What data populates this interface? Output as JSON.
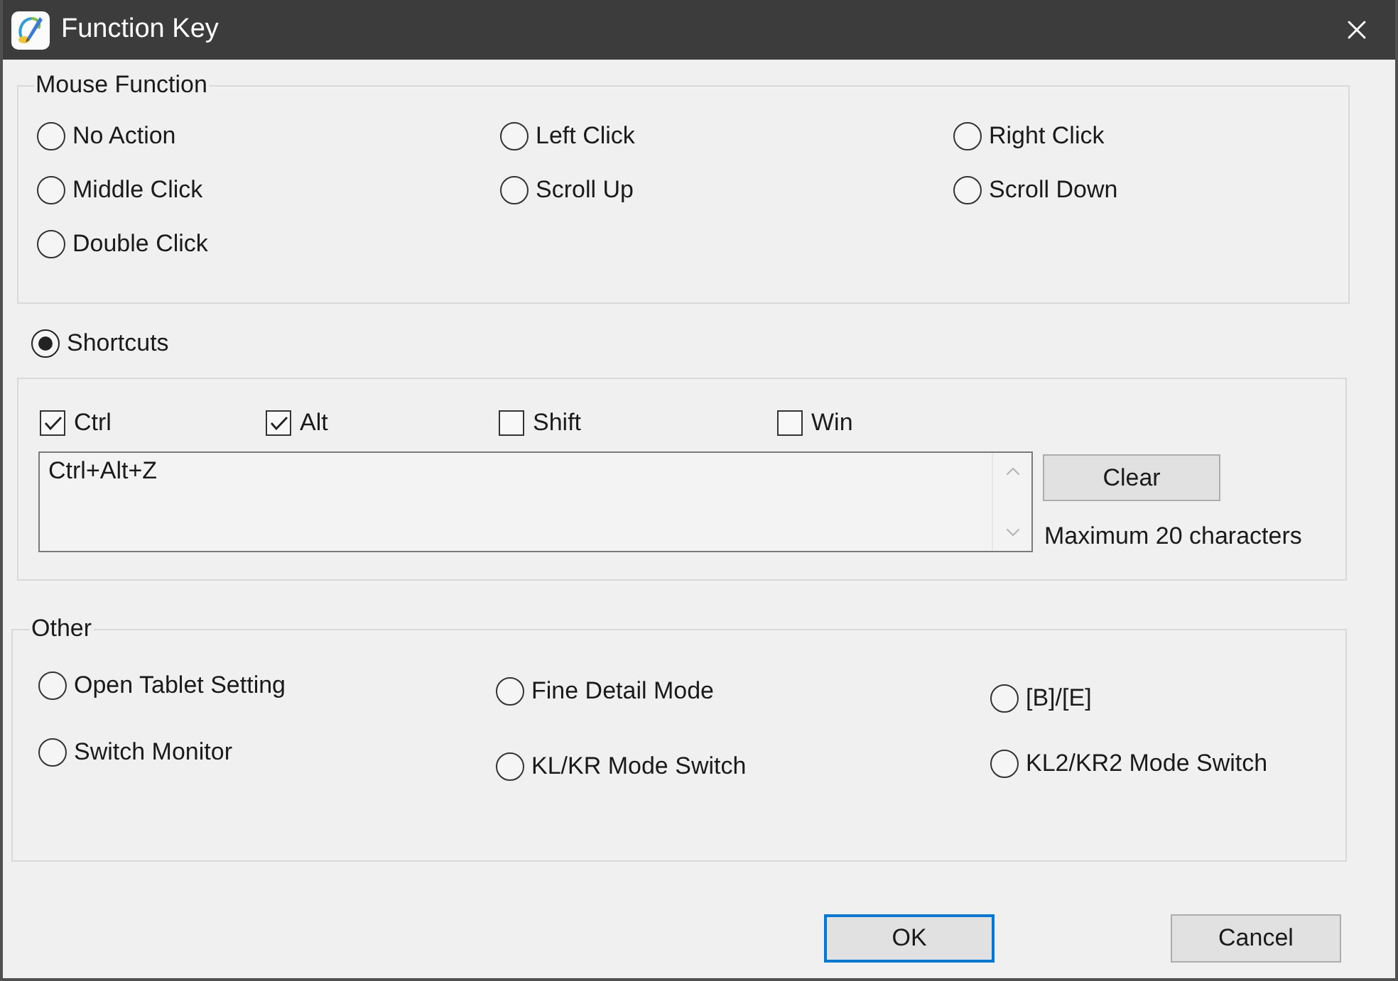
{
  "window": {
    "title": "Function Key"
  },
  "mouse_function": {
    "label": "Mouse Function",
    "options": [
      {
        "label": "No Action",
        "selected": false
      },
      {
        "label": "Left Click",
        "selected": false
      },
      {
        "label": "Right Click",
        "selected": false
      },
      {
        "label": "Middle Click",
        "selected": false
      },
      {
        "label": "Scroll Up",
        "selected": false
      },
      {
        "label": "Scroll Down",
        "selected": false
      },
      {
        "label": "Double Click",
        "selected": false
      }
    ]
  },
  "shortcuts": {
    "label": "Shortcuts",
    "selected": true,
    "modifiers": [
      {
        "label": "Ctrl",
        "checked": true
      },
      {
        "label": "Alt",
        "checked": true
      },
      {
        "label": "Shift",
        "checked": false
      },
      {
        "label": "Win",
        "checked": false
      }
    ],
    "key_field": {
      "value": "Ctrl+Alt+Z"
    },
    "clear_button": {
      "label": "Clear"
    },
    "hint": "Maximum 20 characters"
  },
  "other": {
    "label": "Other",
    "options": [
      {
        "label": "Open Tablet Setting",
        "selected": false
      },
      {
        "label": "Fine Detail Mode",
        "selected": false
      },
      {
        "label": "[B]/[E]",
        "selected": false
      },
      {
        "label": "Switch Monitor",
        "selected": false
      },
      {
        "label": "KL/KR Mode Switch",
        "selected": false
      },
      {
        "label": "KL2/KR2 Mode Switch",
        "selected": false
      }
    ]
  },
  "buttons": [
    {
      "label": "OK",
      "default": true
    },
    {
      "label": "Cancel",
      "default": false
    }
  ]
}
